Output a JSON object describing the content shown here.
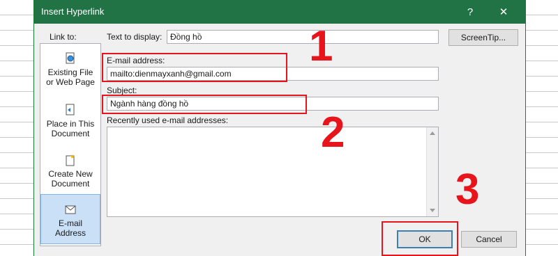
{
  "dialog": {
    "title": "Insert Hyperlink",
    "help_glyph": "?",
    "close_glyph": "✕"
  },
  "link_to": {
    "label": "Link to:",
    "items": [
      {
        "line1": "Existing File",
        "line2": "or Web Page",
        "icon": "globe-page-icon"
      },
      {
        "line1": "Place in This",
        "line2": "Document",
        "icon": "document-bookmark-icon"
      },
      {
        "line1": "Create New",
        "line2": "Document",
        "icon": "new-document-icon"
      },
      {
        "line1": "E-mail",
        "line2": "Address",
        "icon": "email-icon",
        "selected": true
      }
    ]
  },
  "text_to_display": {
    "label": "Text to display:",
    "value": "Đồng hồ"
  },
  "screentip_button": "ScreenTip...",
  "email": {
    "label": "E-mail address:",
    "value": "mailto:dienmayxanh@gmail.com"
  },
  "subject": {
    "label": "Subject:",
    "value": "Ngành hàng đồng hồ"
  },
  "recent": {
    "label": "Recently used e-mail addresses:",
    "items": []
  },
  "buttons": {
    "ok": "OK",
    "cancel": "Cancel"
  },
  "annotations": [
    "1",
    "2",
    "3"
  ],
  "colors": {
    "titlebar": "#217346",
    "annotation": "#e8141c",
    "selected_item": "#c9e0f7"
  }
}
